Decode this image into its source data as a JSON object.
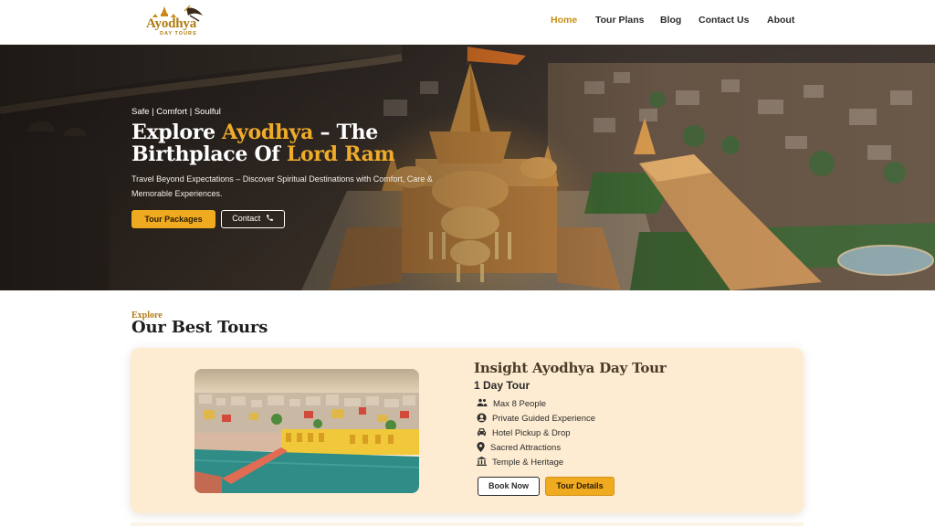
{
  "header": {
    "logo": {
      "name": "Ayodhya",
      "sub": "DAY TOURS"
    },
    "nav": [
      {
        "label": "Home",
        "active": true
      },
      {
        "label": "Tour Plans",
        "active": false
      },
      {
        "label": "Blog",
        "active": false
      },
      {
        "label": "Contact Us",
        "active": false
      },
      {
        "label": "About",
        "active": false
      }
    ]
  },
  "hero": {
    "tagline": "Safe | Comfort | Soulful",
    "title_part1": "Explore ",
    "title_highlight1": "Ayodhya",
    "title_part2": " – The Birthplace Of ",
    "title_highlight2": "Lord Ram",
    "description": "Travel Beyond Expectations – Discover Spiritual Destinations with Comfort, Care & Memorable Experiences.",
    "primary_button": "Tour Packages",
    "secondary_button": "Contact",
    "secondary_button_icon": "phone-icon"
  },
  "tours_section": {
    "kicker": "Explore",
    "title": "Our Best Tours",
    "card": {
      "title": "Insight Ayodhya Day Tour",
      "subtitle": "1 Day Tour",
      "features": [
        {
          "icon": "group-icon",
          "text": "Max 8 People"
        },
        {
          "icon": "user-circle-icon",
          "text": "Private Guided Experience"
        },
        {
          "icon": "car-icon",
          "text": "Hotel Pickup & Drop"
        },
        {
          "icon": "map-pin-icon",
          "text": "Sacred Attractions"
        },
        {
          "icon": "temple-icon",
          "text": "Temple & Heritage"
        }
      ],
      "book_button": "Book Now",
      "details_button": "Tour Details"
    }
  },
  "colors": {
    "accent_gold": "#f0aa20",
    "logo_gold": "#b07a10",
    "card_background": "#fdecd1",
    "nav_active": "#c79015"
  }
}
